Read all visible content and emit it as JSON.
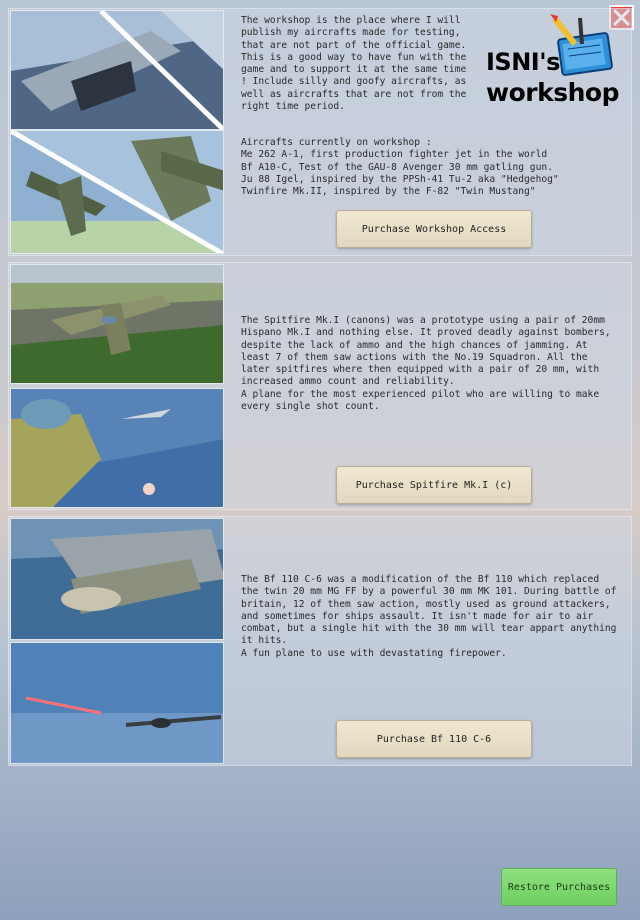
{
  "workshop": {
    "description": "The workshop is the place where I will\npublish my aircrafts made for testing,\nthat are not part of the official game.\nThis is a good way to have fun with the\ngame and to support it at the same time\n! Include silly and goofy aircrafts, as\nwell as aircrafts that are not from the\nright time period.",
    "aircraft_list": "Aircrafts currently on workshop :\nMe 262 A-1, first production fighter jet in the world\nBf A10-C, Test of the GAU-8 Avenger 30 mm gatling gun.\nJu 88 Igel, inspired by the PPSh-41 Tu-2 aka \"Hedgehog\"\nTwinfire Mk.II, inspired by the F-82 \"Twin Mustang\"",
    "button_label": "Purchase Workshop Access",
    "logo_line1": "ISNI's",
    "logo_line2": "workshop"
  },
  "spitfire": {
    "description": "The Spitfire Mk.I (canons) was a prototype using a pair of 20mm\nHispano Mk.I and nothing else. It proved deadly against bombers,\ndespite the lack of ammo and the high chances of jamming. At\nleast 7 of them saw actions with the No.19 Squadron. All the\nlater spitfires where then equipped with a pair of 20 mm, with\nincreased ammo count and reliability.\nA plane for the most experienced pilot who are willing to make\nevery single shot count.",
    "button_label": "Purchase Spitfire Mk.I (c)"
  },
  "bf110": {
    "description": "The Bf 110 C-6 was a modification of the Bf 110 which replaced\nthe twin 20 mm MG FF by a powerful 30 mm MK 101. During battle of\nbritain, 12 of them saw action, mostly used as ground attackers,\nand sometimes for ships assault. It isn't made for air to air\ncombat, but a single hit with the 30 mm will tear appart anything\nit hits.\nA fun plane to use with devastating firepower.",
    "button_label": "Purchase Bf 110 C-6"
  },
  "restore_label": "Restore Purchases",
  "colors": {
    "close_button": "#e53a36",
    "purchase_button": "#e9e0c8",
    "restore_button": "#7ed66f"
  }
}
